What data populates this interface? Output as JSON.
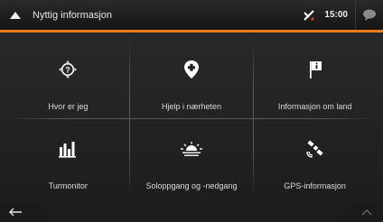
{
  "header": {
    "title": "Nyttig informasjon",
    "time": "15:00"
  },
  "tiles": [
    {
      "label": "Hvor er jeg",
      "icon": "location-question-icon"
    },
    {
      "label": "Hjelp i nærheten",
      "icon": "help-pin-icon"
    },
    {
      "label": "Informasjon om land",
      "icon": "country-info-flag-icon"
    },
    {
      "label": "Turmonitor",
      "icon": "trip-monitor-bars-icon"
    },
    {
      "label": "Soloppgang og -nedgang",
      "icon": "sunrise-sunset-icon"
    },
    {
      "label": "GPS-informasjon",
      "icon": "satellite-icon"
    }
  ],
  "colors": {
    "accent": "#f07a1e",
    "background": "#222222",
    "text": "#dcdcdc"
  }
}
